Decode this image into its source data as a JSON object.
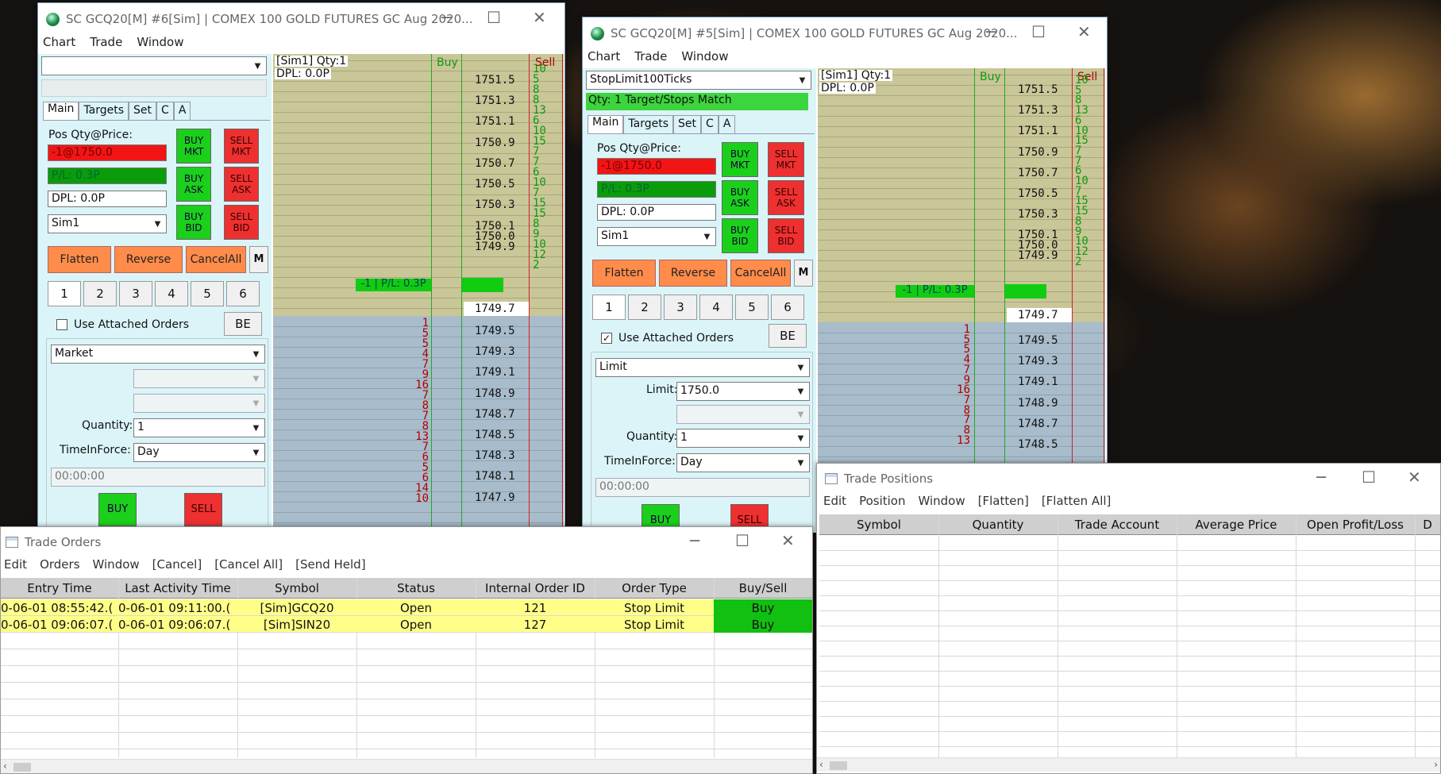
{
  "win1": {
    "title": "SC GCQ20[M]  #6[Sim]  | COMEX 100 GOLD FUTURES GC Aug 2020...",
    "menu": [
      "Chart",
      "Trade",
      "Window"
    ],
    "top_combo": "",
    "tabs": [
      "Main",
      "Targets",
      "Set",
      "C",
      "A"
    ],
    "pos_label": "Pos Qty@Price:",
    "pos_value": "-1@1750.0",
    "pl_value": "P/L: 0.3P",
    "dpl_value": "DPL: 0.0P",
    "account": "Sim1",
    "buy_mkt": "BUY\nMKT",
    "sell_mkt": "SELL\nMKT",
    "buy_ask": "BUY\nASK",
    "sell_ask": "SELL\nASK",
    "buy_bid": "BUY\nBID",
    "sell_bid": "SELL\nBID",
    "flatten": "Flatten",
    "reverse": "Reverse",
    "cancel_all": "CancelAll",
    "m": "M",
    "nums": [
      "1",
      "2",
      "3",
      "4",
      "5",
      "6"
    ],
    "use_attached": "Use Attached Orders",
    "use_attached_checked": false,
    "be": "BE",
    "order_type": "Market",
    "quantity_label": "Quantity:",
    "quantity": "1",
    "tif_label": "TimeInForce:",
    "tif": "Day",
    "time": "00:00:00",
    "buy": "BUY",
    "sell": "SELL",
    "dom_header_left": "[Sim1]  Qty:1",
    "dom_header_dpl": "DPL: 0.0P",
    "dom_buy": "Buy",
    "dom_sell": "Sell",
    "pl_marker": "-1 | P/L: 0.3P",
    "ask_prices": [
      "1751.5",
      "1751.3",
      "1751.1",
      "1750.9",
      "1750.7",
      "1750.5",
      "1750.3",
      "1750.1",
      "1750.0",
      "1749.9"
    ],
    "ask_sizes": [
      "10",
      "5",
      "8",
      "8",
      "13",
      "6",
      "10",
      "15",
      "7",
      "7",
      "6",
      "10",
      "7",
      "15",
      "15",
      "8",
      "9",
      "10",
      "12",
      "2"
    ],
    "last_price": "1749.7",
    "bid_prices": [
      "1749.5",
      "1749.3",
      "1749.1",
      "1748.9",
      "1748.7",
      "1748.5",
      "1748.3",
      "1748.1",
      "1747.9"
    ],
    "bid_sizes": [
      "1",
      "5",
      "5",
      "4",
      "7",
      "9",
      "16",
      "7",
      "8",
      "7",
      "8",
      "13",
      "7",
      "6",
      "5",
      "6",
      "14",
      "10"
    ]
  },
  "win2": {
    "title": "SC GCQ20[M]  #5[Sim]  | COMEX 100 GOLD FUTURES GC Aug 2020...",
    "menu": [
      "Chart",
      "Trade",
      "Window"
    ],
    "top_combo": "StopLimit100Ticks",
    "status": "Qty: 1 Target/Stops Match",
    "tabs": [
      "Main",
      "Targets",
      "Set",
      "C",
      "A"
    ],
    "pos_label": "Pos Qty@Price:",
    "pos_value": "-1@1750.0",
    "pl_value": "P/L: 0.3P",
    "dpl_value": "DPL: 0.0P",
    "account": "Sim1",
    "buy_mkt": "BUY\nMKT",
    "sell_mkt": "SELL\nMKT",
    "buy_ask": "BUY\nASK",
    "sell_ask": "SELL\nASK",
    "buy_bid": "BUY\nBID",
    "sell_bid": "SELL\nBID",
    "flatten": "Flatten",
    "reverse": "Reverse",
    "cancel_all": "CancelAll",
    "m": "M",
    "nums": [
      "1",
      "2",
      "3",
      "4",
      "5",
      "6"
    ],
    "use_attached": "Use Attached Orders",
    "use_attached_checked": true,
    "be": "BE",
    "order_type": "Limit",
    "limit_label": "Limit:",
    "limit": "1750.0",
    "quantity_label": "Quantity:",
    "quantity": "1",
    "tif_label": "TimeInForce:",
    "tif": "Day",
    "time": "00:00:00",
    "buy": "BUY",
    "sell": "SELL",
    "dom_header_left": "[Sim1]  Qty:1",
    "dom_header_dpl": "DPL: 0.0P",
    "dom_buy": "Buy",
    "dom_sell": "Sell",
    "pl_marker": "-1 | P/L: 0.3P",
    "ask_prices": [
      "1751.5",
      "1751.3",
      "1751.1",
      "1750.9",
      "1750.7",
      "1750.5",
      "1750.3",
      "1750.1",
      "1750.0",
      "1749.9"
    ],
    "ask_sizes": [
      "10",
      "5",
      "8",
      "13",
      "6",
      "10",
      "15",
      "7",
      "7",
      "6",
      "10",
      "7",
      "15",
      "15",
      "8",
      "9",
      "10",
      "12",
      "2"
    ],
    "last_price": "1749.7",
    "bid_prices": [
      "1749.5",
      "1749.3",
      "1749.1",
      "1748.9",
      "1748.7",
      "1748.5"
    ],
    "bid_sizes": [
      "1",
      "5",
      "5",
      "4",
      "7",
      "9",
      "16",
      "7",
      "8",
      "7",
      "8",
      "13"
    ]
  },
  "orders": {
    "title": "Trade Orders",
    "menu": [
      "Edit",
      "Orders",
      "Window",
      "[Cancel]",
      "[Cancel All]",
      "[Send Held]"
    ],
    "columns": [
      "Entry Time",
      "Last Activity Time",
      "Symbol",
      "Status",
      "Internal Order ID",
      "Order Type",
      "Buy/Sell"
    ],
    "rows": [
      [
        "0-06-01  08:55:42.(",
        "0-06-01  09:11:00.(",
        "[Sim]GCQ20",
        "Open",
        "121",
        "Stop Limit",
        "Buy"
      ],
      [
        "0-06-01  09:06:07.(",
        "0-06-01  09:06:07.(",
        "[Sim]SIN20",
        "Open",
        "127",
        "Stop Limit",
        "Buy"
      ]
    ]
  },
  "positions": {
    "title": "Trade Positions",
    "menu": [
      "Edit",
      "Position",
      "Window",
      "[Flatten]",
      "[Flatten All]"
    ],
    "columns": [
      "Symbol",
      "Quantity",
      "Trade Account",
      "Average Price",
      "Open Profit/Loss",
      "D"
    ]
  },
  "colors": {
    "ask_bg": "#c9c698",
    "bid_bg": "#a8bccb",
    "buy_green": "#1bd01b",
    "sell_red": "#ef3030",
    "order_row": "#ffff88"
  }
}
